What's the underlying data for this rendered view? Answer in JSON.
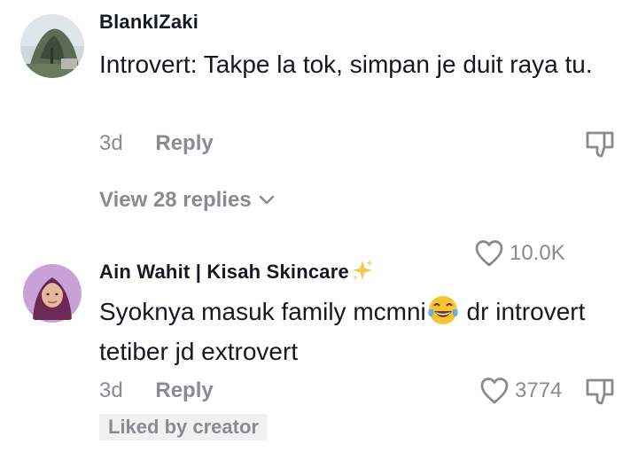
{
  "comments": [
    {
      "username": "BlankIZaki",
      "text": "Introvert: Takpe la tok, simpan je duit raya tu.",
      "age": "3d",
      "reply_label": "Reply",
      "like_count": "10.0K",
      "view_replies": "View 28 replies",
      "avatar_icon": "tree-landscape-photo"
    },
    {
      "username": "Ain Wahit | Kisah Skincare",
      "text_part1": "Syoknya masuk family mcmni",
      "text_part2": " dr introvert tetiber jd extrovert",
      "age": "3d",
      "reply_label": "Reply",
      "like_count": "3774",
      "liked_by_creator": "Liked by creator",
      "avatar_icon": "hijab-woman-portrait",
      "emojis": [
        "sparkles",
        "tears-of-joy"
      ]
    }
  ],
  "colors": {
    "text": "#161823",
    "muted": "#8a8b91",
    "badge_bg": "#f1f1f2",
    "sparkle": "#f2c94c"
  }
}
